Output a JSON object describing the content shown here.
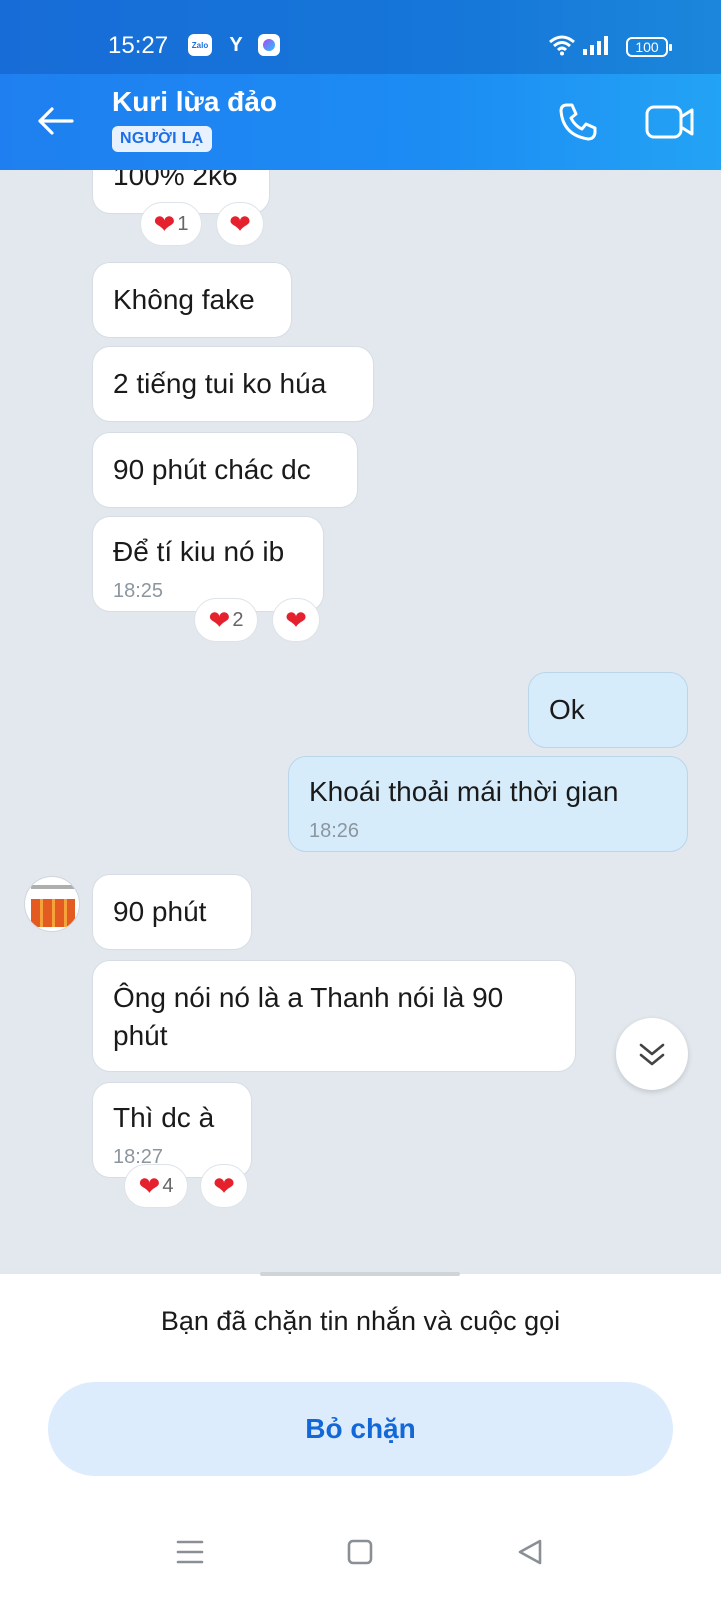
{
  "status_bar": {
    "time": "15:27",
    "zalo_label": "Zalo",
    "battery": "100",
    "icons": [
      "zalo-icon",
      "y-icon",
      "app-icon",
      "wifi-icon",
      "signal-icon",
      "battery-icon"
    ]
  },
  "header": {
    "contact_name": "Kuri lừa đảo",
    "tag": "NGƯỜI LẠ",
    "icons": [
      "back-arrow-icon",
      "phone-icon",
      "video-camera-icon"
    ]
  },
  "messages": [
    {
      "sender": "them",
      "text": "100% 2k6",
      "reactions": {
        "count": "1"
      }
    },
    {
      "sender": "them",
      "text": "Không fake"
    },
    {
      "sender": "them",
      "text": "2 tiếng tui ko húa"
    },
    {
      "sender": "them",
      "text": "90 phút chác dc"
    },
    {
      "sender": "them",
      "text": "Để tí kiu nó ib",
      "time": "18:25",
      "reactions": {
        "count": "2"
      }
    },
    {
      "sender": "me",
      "text": "Ok"
    },
    {
      "sender": "me",
      "text": "Khoái thoải mái thời gian",
      "time": "18:26"
    },
    {
      "sender": "them",
      "text": "90 phút"
    },
    {
      "sender": "them",
      "text": "Ông nói nó là a Thanh nói là 90 phút"
    },
    {
      "sender": "them",
      "text": "Thì dc à",
      "time": "18:27",
      "reactions": {
        "count": "4"
      }
    }
  ],
  "blocked_panel": {
    "message": "Bạn đã chặn tin nhắn và cuộc gọi",
    "button_label": "Bỏ chặn"
  },
  "nav_bar": {
    "icons": [
      "menu-icon",
      "home-icon",
      "back-icon"
    ]
  },
  "colors": {
    "header_blue": "#1c8cf3",
    "my_bubble": "#d6ecfb",
    "chat_bg": "#e2e8ee",
    "heart": "#e5212e",
    "unblock_text": "#1268d6"
  }
}
